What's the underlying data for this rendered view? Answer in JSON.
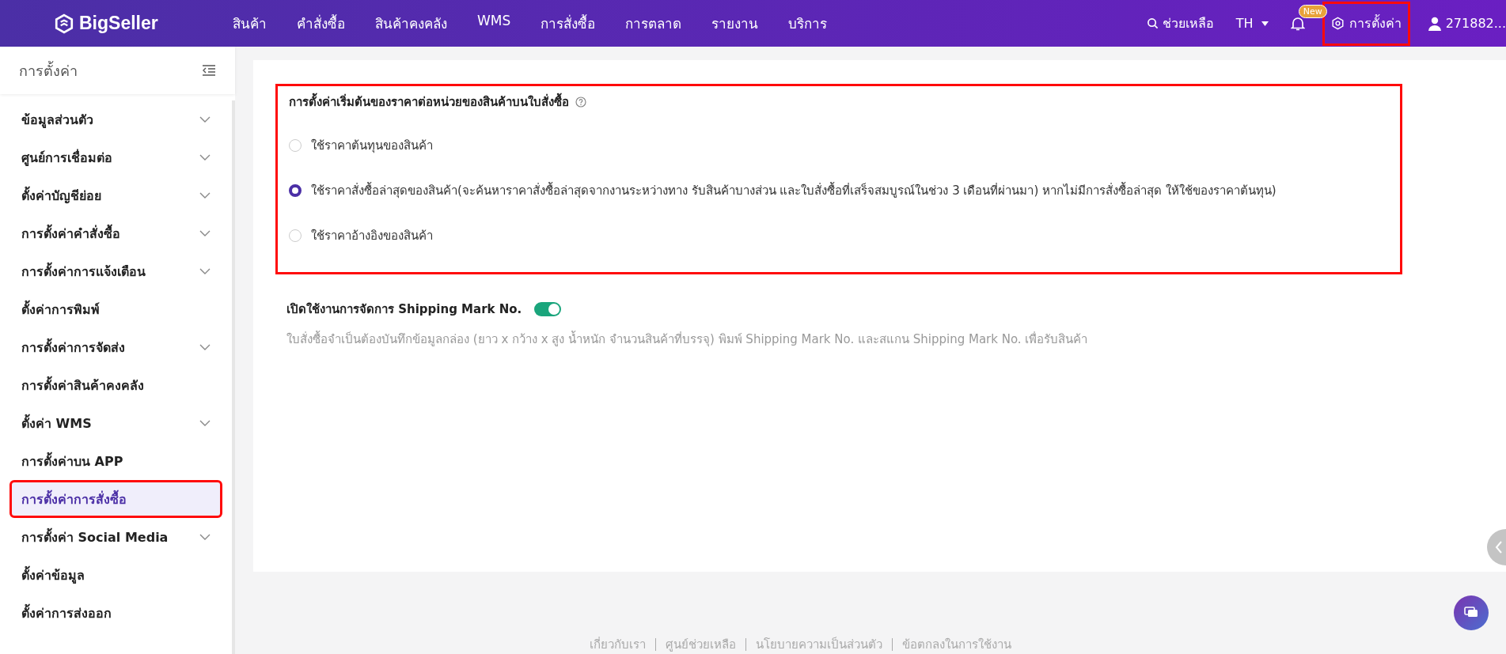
{
  "header": {
    "logo": "BigSeller",
    "nav": [
      "สินค้า",
      "คำสั่งซื้อ",
      "สินค้าคงคลัง",
      "WMS",
      "การสั่งซื้อ",
      "การตลาด",
      "รายงาน",
      "บริการ"
    ],
    "help": "ช่วยเหลือ",
    "language": "TH",
    "notification_badge": "New",
    "settings": {
      "label": "การตั้งค่า",
      "highlighted": true
    },
    "account": "271882..."
  },
  "sidebar": {
    "title": "การตั้งค่า",
    "items": [
      {
        "label": "ข้อมูลส่วนตัว",
        "expandable": true,
        "selected": false,
        "highlighted": false
      },
      {
        "label": "ศูนย์การเชื่อมต่อ",
        "expandable": true,
        "selected": false,
        "highlighted": false
      },
      {
        "label": "ตั้งค่าบัญชีย่อย",
        "expandable": true,
        "selected": false,
        "highlighted": false
      },
      {
        "label": "การตั้งค่าคำสั่งซื้อ",
        "expandable": true,
        "selected": false,
        "highlighted": false
      },
      {
        "label": "การตั้งค่าการแจ้งเตือน",
        "expandable": true,
        "selected": false,
        "highlighted": false
      },
      {
        "label": "ตั้งค่าการพิมพ์",
        "expandable": false,
        "selected": false,
        "highlighted": false
      },
      {
        "label": "การตั้งค่าการจัดส่ง",
        "expandable": true,
        "selected": false,
        "highlighted": false
      },
      {
        "label": "การตั้งค่าสินค้าคงคลัง",
        "expandable": false,
        "selected": false,
        "highlighted": false
      },
      {
        "label": "ตั้งค่า WMS",
        "expandable": true,
        "selected": false,
        "highlighted": false
      },
      {
        "label": "การตั้งค่าบน APP",
        "expandable": false,
        "selected": false,
        "highlighted": false
      },
      {
        "label": "การตั้งค่าการสั่งซื้อ",
        "expandable": false,
        "selected": true,
        "highlighted": true
      },
      {
        "label": "การตั้งค่า Social Media",
        "expandable": true,
        "selected": false,
        "highlighted": false
      },
      {
        "label": "ตั้งค่าข้อมูล",
        "expandable": false,
        "selected": false,
        "highlighted": false
      },
      {
        "label": "ตั้งค่าการส่งออก",
        "expandable": false,
        "selected": false,
        "highlighted": false
      }
    ]
  },
  "price_setting": {
    "title": "การตั้งค่าเริ่มต้นของราคาต่อหน่วยของสินค้าบนใบสั่งซื้อ",
    "highlighted": true,
    "options": [
      {
        "label": "ใช้ราคาต้นทุนของสินค้า",
        "selected": false
      },
      {
        "label": "ใช้ราคาสั่งซื้อล่าสุดของสินค้า(จะค้นหาราคาสั่งซื้อล่าสุดจากงานระหว่างทาง รับสินค้าบางส่วน และใบสั่งซื้อที่เสร็จสมบูรณ์ในช่วง 3 เดือนที่ผ่านมา) หากไม่มีการสั่งซื้อล่าสุด ให้ใช้ของราคาต้นทุน)",
        "selected": true
      },
      {
        "label": "ใช้ราคาอ้างอิงของสินค้า",
        "selected": false
      }
    ]
  },
  "shipping_mark": {
    "title": "เปิดใช้งานการจัดการ Shipping Mark No.",
    "on": true,
    "description": "ใบสั่งซื้อจำเป็นต้องบันทึกข้อมูลกล่อง (ยาว x กว้าง x สูง น้ำหนัก จำนวนสินค้าที่บรรจุ) พิมพ์ Shipping Mark No. และสแกน Shipping Mark No. เพื่อรับสินค้า"
  },
  "footer": {
    "links": [
      "เกี่ยวกับเรา",
      "ศูนย์ช่วยเหลือ",
      "นโยบายความเป็นส่วนตัว",
      "ข้อตกลงในการใช้งาน"
    ]
  }
}
